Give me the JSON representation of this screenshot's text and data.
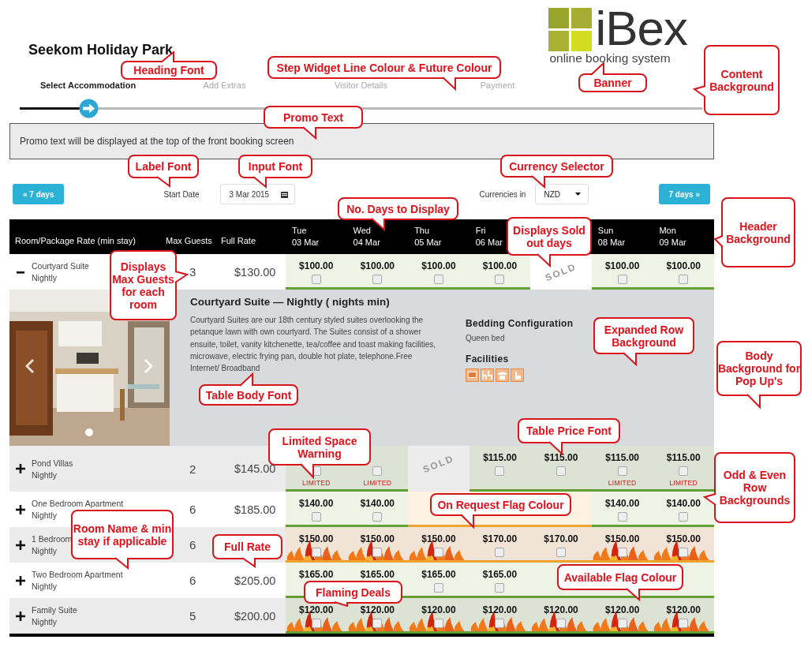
{
  "park_name": "Seekom Holiday Park",
  "logo": {
    "wordmark": "iBex",
    "tagline": "online booking system"
  },
  "steps": [
    {
      "label": "Select Accommodation",
      "selected": true
    },
    {
      "label": "Add Extras",
      "selected": false
    },
    {
      "label": "Visitor Details",
      "selected": false
    },
    {
      "label": "Payment",
      "selected": false
    }
  ],
  "promo_text": "Promo text will be displayed at the top of the front booking screen",
  "controls": {
    "prev_button": "« 7 days",
    "start_date_label": "Start Date",
    "start_date": "3 Mar 2015",
    "currency_label": "Currencies in",
    "currency": "NZD",
    "next_button": "7 days »"
  },
  "table": {
    "columns": [
      "Room/Package Rate (min stay)",
      "Max Guests",
      "Full Rate"
    ],
    "days": [
      {
        "day": "Tue",
        "date": "03 Mar"
      },
      {
        "day": "Wed",
        "date": "04 Mar"
      },
      {
        "day": "Thu",
        "date": "05 Mar"
      },
      {
        "day": "Fri",
        "date": "06 Mar"
      },
      {
        "covered": true
      },
      {
        "day": "Sun",
        "date": "08 Mar"
      },
      {
        "day": "Mon",
        "date": "09 Mar"
      }
    ],
    "rows": [
      {
        "name": "Courtyard Suite",
        "rate_type": "Nightly",
        "expanded": true,
        "max_guests": "3",
        "full_rate": "$130.00",
        "cells": [
          {
            "kind": "available",
            "price": "$100.00",
            "checked": false
          },
          {
            "kind": "available",
            "price": "$100.00",
            "checked": false
          },
          {
            "kind": "available",
            "price": "$100.00",
            "checked": false
          },
          {
            "kind": "available",
            "price": "$100.00",
            "checked": false
          },
          {
            "kind": "sold",
            "label": "SOLD"
          },
          {
            "kind": "available",
            "price": "$100.00",
            "checked": false
          },
          {
            "kind": "available",
            "price": "$100.00",
            "checked": false
          }
        ],
        "details": {
          "title": "Courtyard Suite — Nightly ( nights min)",
          "description": "Courtyard Suites are our 18th century styled suites overlooking the petanque lawn with own courtyard. The Suites consist of a shower ensuite, toilet, vanity kitchenette, tea/coffee and toast making facilities, microwave, electric frying pan, double hot plate, telephone.Free Internet/ Broadband",
          "bedding_heading": "Bedding Configuration",
          "bedding": "Queen bed",
          "facilities_heading": "Facilities"
        }
      },
      {
        "name": "Pond Villas",
        "rate_type": "Nightly",
        "expanded": false,
        "max_guests": "2",
        "full_rate": "$145.00",
        "cells": [
          {
            "kind": "available",
            "checked": false,
            "note": "LIMITED"
          },
          {
            "kind": "available",
            "checked": false,
            "note": "LIMITED"
          },
          {
            "kind": "sold",
            "label": "SOLD"
          },
          {
            "kind": "available",
            "price": "$115.00",
            "checked": false
          },
          {
            "kind": "available",
            "price": "$115.00",
            "checked": false
          },
          {
            "kind": "available",
            "price": "$115.00",
            "checked": false,
            "note": "LIMITED"
          },
          {
            "kind": "available",
            "price": "$115.00",
            "checked": false,
            "note": "LIMITED"
          }
        ]
      },
      {
        "name": "One Bedroom Apartment",
        "rate_type": "Nightly",
        "expanded": false,
        "max_guests": "6",
        "full_rate": "$185.00",
        "cells": [
          {
            "kind": "available",
            "price": "$140.00",
            "checked": false
          },
          {
            "kind": "available",
            "price": "$140.00",
            "checked": false
          },
          {
            "kind": "on_request"
          },
          {
            "kind": "on_request"
          },
          {
            "kind": "on_request"
          },
          {
            "kind": "available",
            "price": "$140.00",
            "checked": false
          },
          {
            "kind": "available",
            "price": "$140.00",
            "checked": false
          }
        ]
      },
      {
        "name": "1 Bedroom",
        "rate_type": "Nightly",
        "expanded": false,
        "max_guests": "6",
        "cells": [
          {
            "kind": "on_request",
            "price": "$150.00",
            "checked": false,
            "flaming": true
          },
          {
            "kind": "on_request",
            "price": "$150.00",
            "checked": false,
            "flaming": true
          },
          {
            "kind": "on_request",
            "price": "$150.00",
            "checked": false,
            "flaming": true
          },
          {
            "kind": "on_request",
            "price": "$170.00",
            "checked": false,
            "flaming": false
          },
          {
            "kind": "on_request",
            "price": "$170.00",
            "checked": false,
            "flaming": false
          },
          {
            "kind": "on_request",
            "price": "$150.00",
            "checked": false,
            "flaming": true
          },
          {
            "kind": "on_request",
            "price": "$150.00",
            "checked": false,
            "flaming": true
          }
        ]
      },
      {
        "name": "Two Bedroom Apartment",
        "rate_type": "Nightly",
        "expanded": false,
        "max_guests": "6",
        "full_rate": "$205.00",
        "cells": [
          {
            "kind": "available",
            "price": "$165.00"
          },
          {
            "kind": "available",
            "price": "$165.00"
          },
          {
            "kind": "available",
            "price": "$165.00",
            "checked": false
          },
          {
            "kind": "available",
            "price": "$165.00",
            "checked": false
          },
          {
            "kind": "available"
          },
          {
            "kind": "available"
          },
          {
            "kind": "available"
          }
        ]
      },
      {
        "name": "Family Suite",
        "rate_type": "Nightly",
        "expanded": false,
        "max_guests": "5",
        "full_rate": "$200.00",
        "cells": [
          {
            "kind": "available",
            "price": "$120.00",
            "checked": false,
            "flaming": true
          },
          {
            "kind": "available",
            "price": "$120.00",
            "checked": false,
            "flaming": true
          },
          {
            "kind": "available",
            "price": "$120.00",
            "checked": false,
            "flaming": true
          },
          {
            "kind": "available",
            "price": "$120.00",
            "checked": false,
            "flaming": true
          },
          {
            "kind": "available",
            "price": "$120.00",
            "checked": false,
            "flaming": true
          },
          {
            "kind": "available",
            "price": "$120.00",
            "checked": false,
            "flaming": true
          },
          {
            "kind": "available",
            "price": "$120.00",
            "checked": false,
            "flaming": true
          }
        ]
      }
    ]
  },
  "callouts": [
    "Heading Font",
    "Step Widget Line Colour & Future Colour",
    "Banner",
    "Content Background",
    "Promo Text",
    "Label Font",
    "Input Font",
    "Currency Selector",
    "No. Days to Display",
    "Displays Sold out days",
    "Header Background",
    "Displays Max Guests for each room",
    "Expanded Row Background",
    "Body Background for Pop Up's",
    "Table Body Font",
    "Table Price Font",
    "Limited Space Warning",
    "Odd & Even Row Backgrounds",
    "On Request Flag Colour",
    "Room Name & min stay if applicable",
    "Full Rate",
    "Available Flag Colour",
    "Flaming Deals"
  ]
}
